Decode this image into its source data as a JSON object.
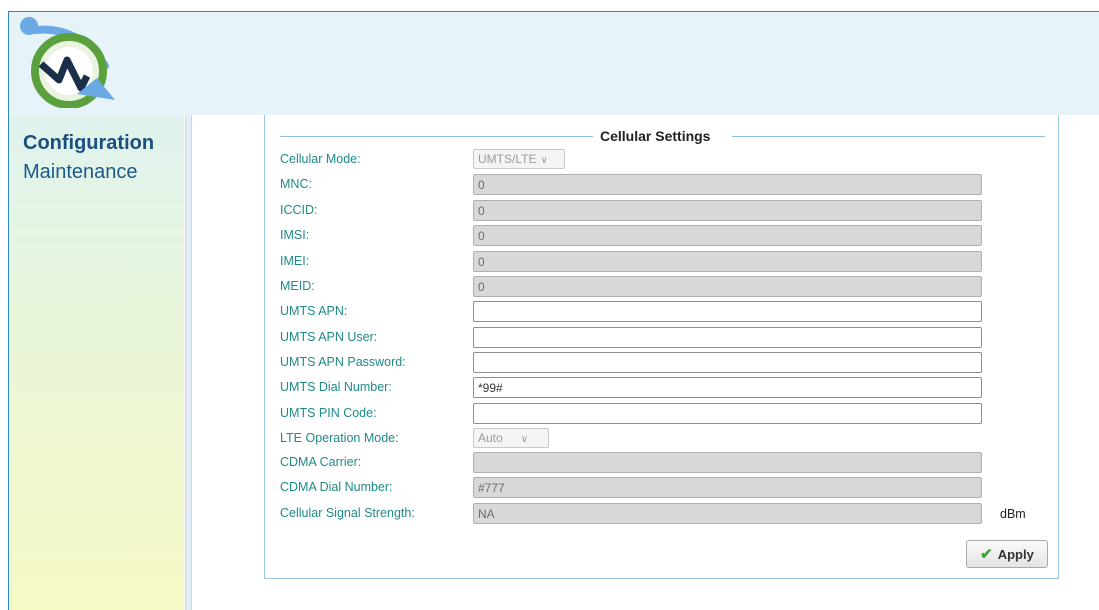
{
  "nav": {
    "items": [
      {
        "label": "Configuration",
        "active": true
      },
      {
        "label": "Maintenance",
        "active": false
      }
    ]
  },
  "logo": {
    "icon": "wave-signal-logo"
  },
  "section": {
    "title": "Cellular Settings"
  },
  "fields": {
    "cellular_mode": {
      "label": "Cellular Mode:",
      "value": "UMTS/LTE"
    },
    "mnc": {
      "label": "MNC:",
      "value": "0"
    },
    "iccid": {
      "label": "ICCID:",
      "value": "0"
    },
    "imsi": {
      "label": "IMSI:",
      "value": "0"
    },
    "imei": {
      "label": "IMEI:",
      "value": "0"
    },
    "meid": {
      "label": "MEID:",
      "value": "0"
    },
    "umts_apn": {
      "label": "UMTS APN:",
      "value": ""
    },
    "umts_apn_user": {
      "label": "UMTS APN User:",
      "value": ""
    },
    "umts_apn_password": {
      "label": "UMTS APN Password:",
      "value": ""
    },
    "umts_dial_number": {
      "label": "UMTS Dial Number:",
      "value": "*99#"
    },
    "umts_pin_code": {
      "label": "UMTS PIN Code:",
      "value": ""
    },
    "lte_operation_mode": {
      "label": "LTE Operation Mode:",
      "value": "Auto"
    },
    "cdma_carrier": {
      "label": "CDMA Carrier:",
      "value": ""
    },
    "cdma_dial_number": {
      "label": "CDMA Dial Number:",
      "value": "#777"
    },
    "signal_strength": {
      "label": "Cellular Signal Strength:",
      "value": "NA",
      "unit": "dBm"
    }
  },
  "apply": {
    "label": "Apply"
  },
  "colors": {
    "accent": "#2e86c1",
    "label": "#1f8a86",
    "nav": "#1d5a8c"
  }
}
